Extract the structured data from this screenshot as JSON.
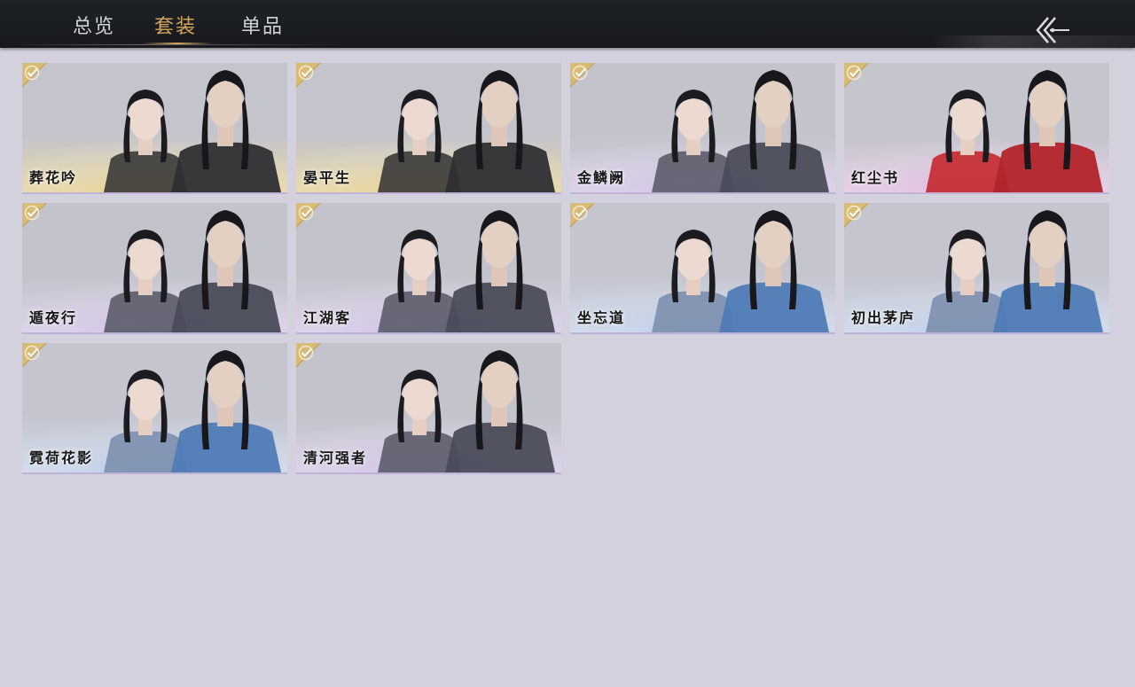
{
  "tabs": [
    {
      "label": "总览"
    },
    {
      "label": "套装"
    },
    {
      "label": "单品"
    }
  ],
  "active_tab": "套装",
  "cards": [
    {
      "name": "葬花吟",
      "theme": "gold",
      "owned": true
    },
    {
      "name": "晏平生",
      "theme": "gold",
      "owned": true
    },
    {
      "name": "金鳞阙",
      "theme": "purple",
      "owned": true
    },
    {
      "name": "红尘书",
      "theme": "red",
      "owned": true
    },
    {
      "name": "遁夜行",
      "theme": "purple",
      "owned": true
    },
    {
      "name": "江湖客",
      "theme": "purple",
      "owned": true
    },
    {
      "name": "坐忘道",
      "theme": "blue",
      "owned": true
    },
    {
      "name": "初出茅庐",
      "theme": "blue",
      "owned": true
    },
    {
      "name": "霓荷花影",
      "theme": "blue",
      "owned": true
    },
    {
      "name": "清河强者",
      "theme": "purple",
      "owned": true
    }
  ],
  "colors": {
    "background": "#d2d1dd",
    "topbar": "#1b1e21",
    "tab_active": "#d3a55c",
    "tab_inactive": "#cfd2d6",
    "check_badge": "#c9a45a"
  },
  "icons": {
    "back": "double-chevron-left-arrow-icon",
    "owned": "checkmark-icon"
  }
}
